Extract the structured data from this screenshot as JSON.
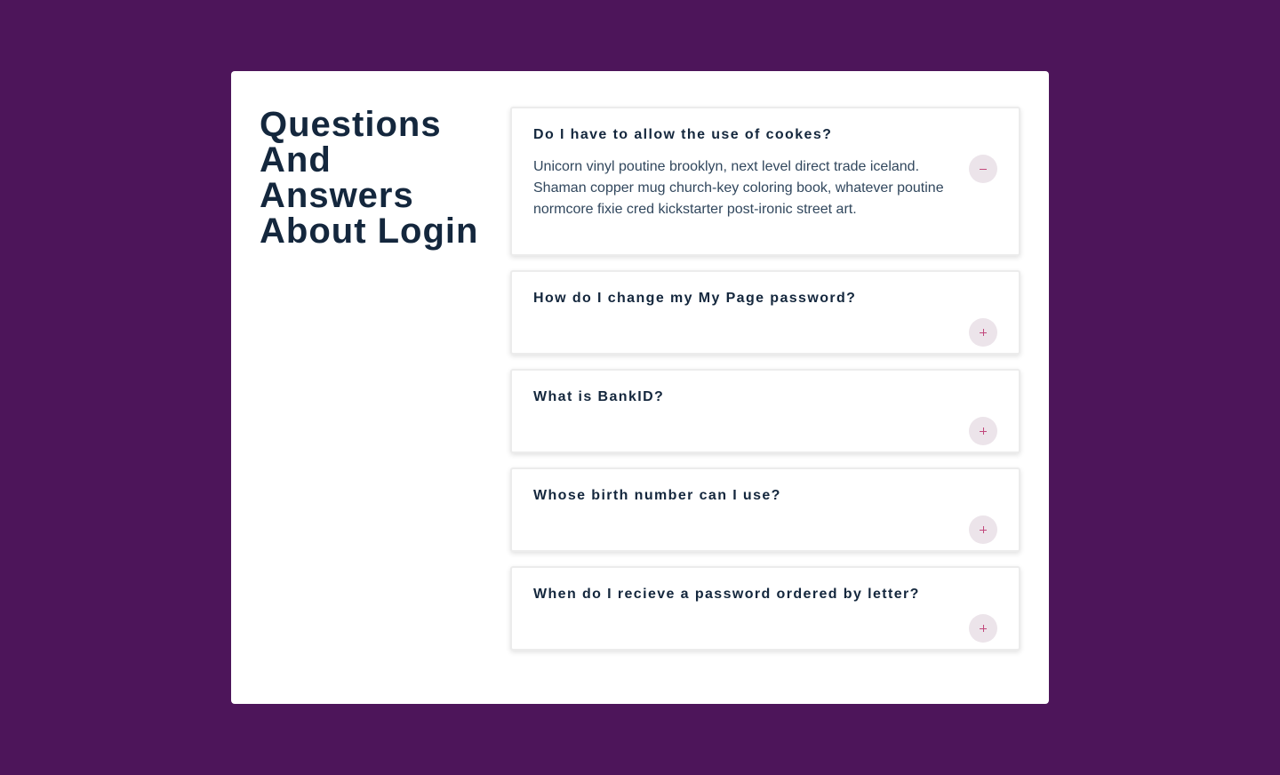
{
  "page": {
    "title": "Questions And Answers About Login",
    "background_color": "#4d155a",
    "accent_color": "#c2487c"
  },
  "faq": {
    "items": [
      {
        "question": "Do I have to allow the use of cookes?",
        "answer": "Unicorn vinyl poutine brooklyn, next level direct trade iceland. Shaman copper mug church-key coloring book, whatever poutine normcore fixie cred kickstarter post-ironic street art.",
        "expanded": true,
        "toggle_icon": "minus-icon"
      },
      {
        "question": "How do I change my My Page password?",
        "expanded": false,
        "toggle_icon": "plus-icon"
      },
      {
        "question": "What is BankID?",
        "expanded": false,
        "toggle_icon": "plus-icon"
      },
      {
        "question": "Whose birth number can I use?",
        "expanded": false,
        "toggle_icon": "plus-icon"
      },
      {
        "question": "When do I recieve a password ordered by letter?",
        "expanded": false,
        "toggle_icon": "plus-icon"
      }
    ]
  }
}
